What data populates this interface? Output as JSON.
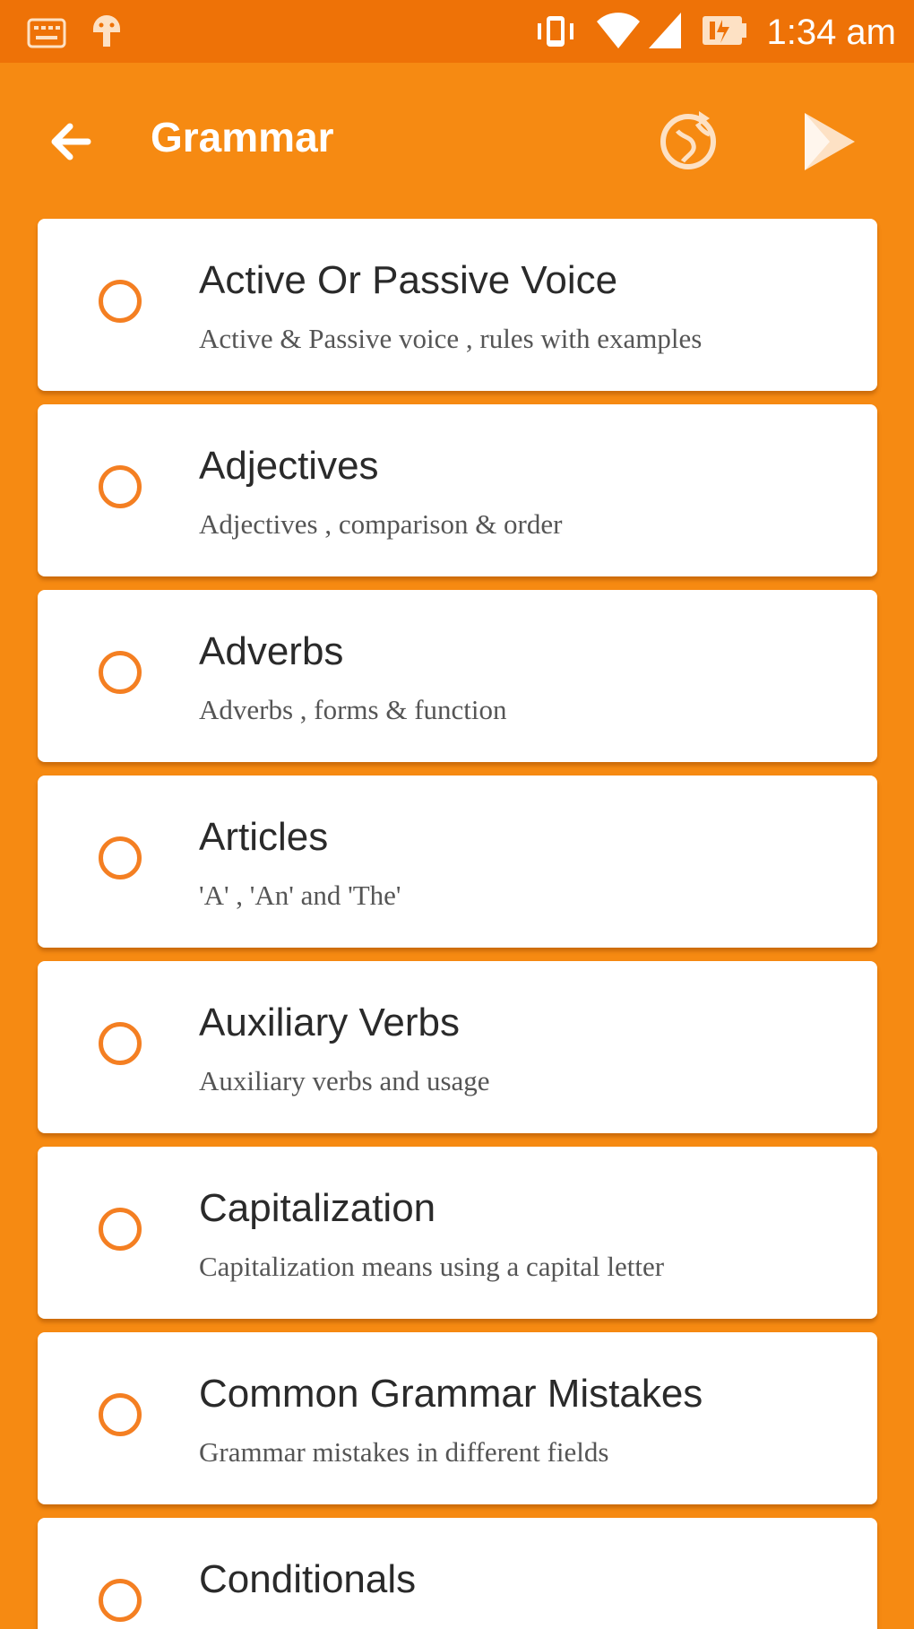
{
  "status_bar": {
    "time": "1:34 am",
    "icons": [
      "keyboard-icon",
      "android-debug-icon",
      "vibrate-icon",
      "wifi-icon",
      "cell-signal-icon",
      "battery-icon"
    ]
  },
  "app_bar": {
    "title": "Grammar",
    "back_icon": "arrow-left-icon",
    "actions": [
      "refresh-globe-icon",
      "play-icon"
    ]
  },
  "topics": [
    {
      "title": "Active Or Passive Voice",
      "subtitle": "Active & Passive voice , rules with examples"
    },
    {
      "title": "Adjectives",
      "subtitle": "Adjectives , comparison & order"
    },
    {
      "title": "Adverbs",
      "subtitle": "Adverbs , forms & function"
    },
    {
      "title": "Articles",
      "subtitle": "'A' , 'An' and 'The'"
    },
    {
      "title": "Auxiliary Verbs",
      "subtitle": "Auxiliary verbs and usage"
    },
    {
      "title": "Capitalization",
      "subtitle": "Capitalization means using a capital letter"
    },
    {
      "title": "Common Grammar Mistakes",
      "subtitle": "Grammar mistakes in different fields"
    },
    {
      "title": "Conditionals",
      "subtitle": ""
    }
  ],
  "colors": {
    "status_bar": "#ee7207",
    "app_bar": "#f68a12",
    "accent": "#f47f22",
    "card": "#ffffff"
  }
}
